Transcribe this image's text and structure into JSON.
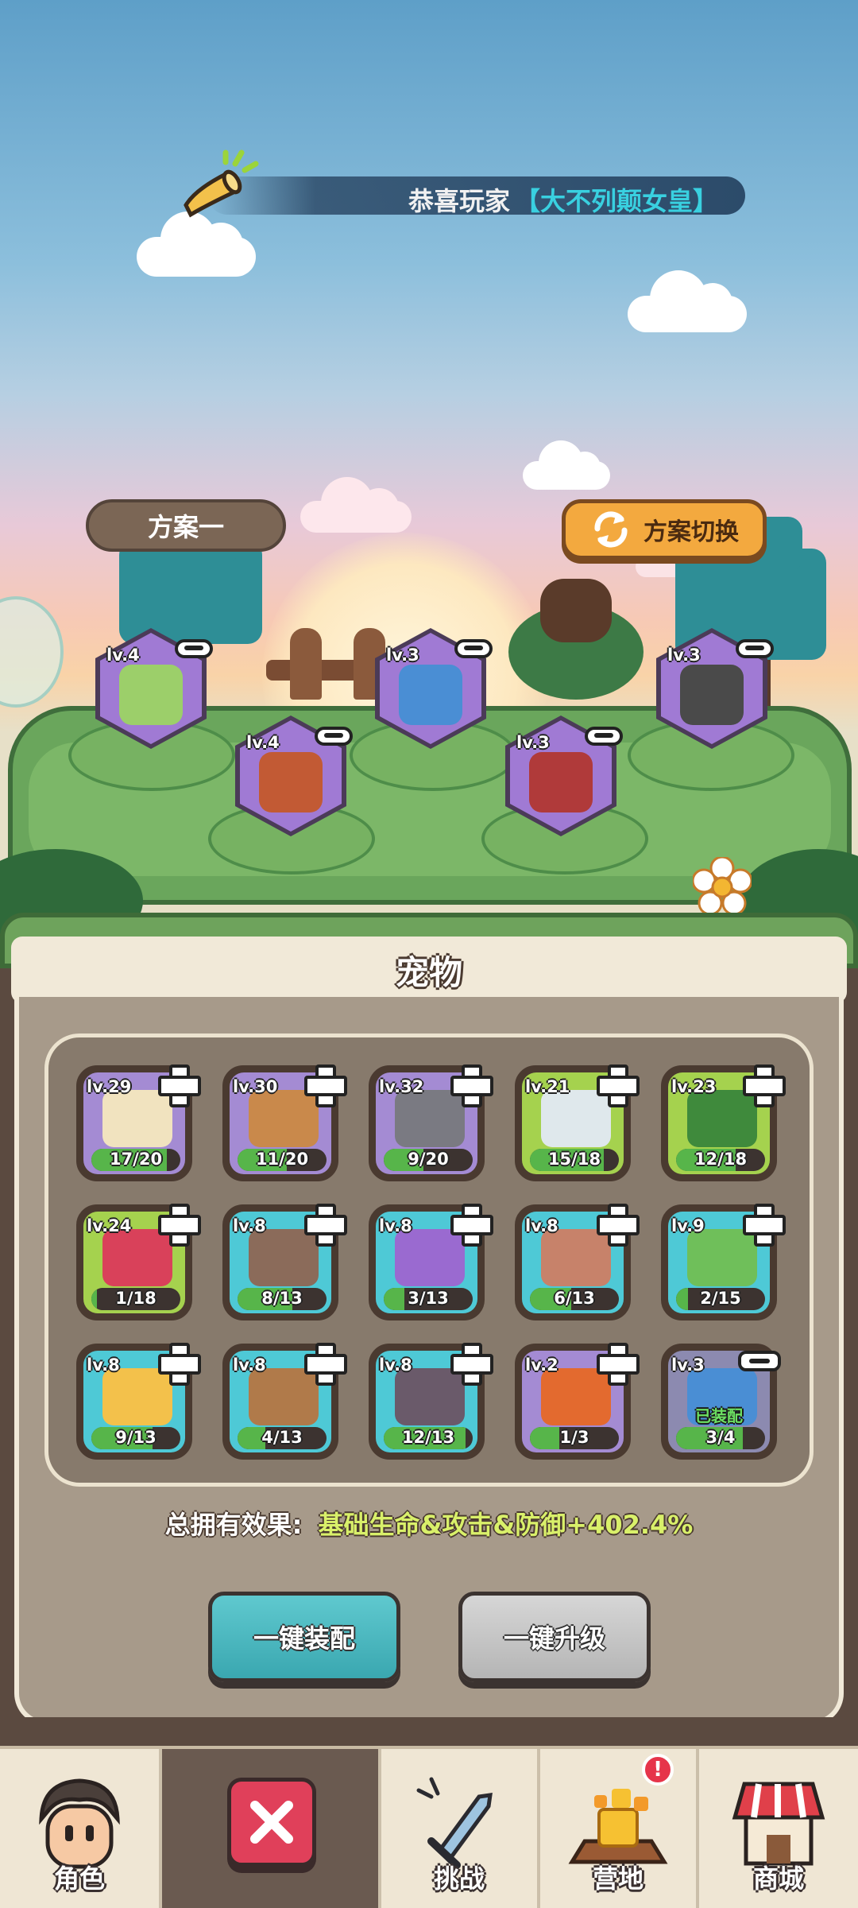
{
  "announcement": {
    "prefix": "恭喜玩家",
    "name": "【大不列颠女皇】"
  },
  "plan": {
    "current": "方案一",
    "switch_label": "方案切换"
  },
  "equipped": [
    {
      "lv": "lv.4",
      "color": "#9ccf6a"
    },
    {
      "lv": "lv.4",
      "color": "#c25a34"
    },
    {
      "lv": "lv.3",
      "color": "#4a8ed4"
    },
    {
      "lv": "lv.3",
      "color": "#b03a3a"
    },
    {
      "lv": "lv.3",
      "color": "#4a4a4a"
    }
  ],
  "panel": {
    "title": "宠物"
  },
  "pets": [
    {
      "lv": "lv.29",
      "count": "17/20",
      "progress": 0.85,
      "frame": "#a48bd3",
      "pet_color": "#f1e3bf",
      "action": "plus"
    },
    {
      "lv": "lv.30",
      "count": "11/20",
      "progress": 0.55,
      "frame": "#a48bd3",
      "pet_color": "#c9894b",
      "action": "plus"
    },
    {
      "lv": "lv.32",
      "count": "9/20",
      "progress": 0.45,
      "frame": "#a48bd3",
      "pet_color": "#7a7a82",
      "action": "plus"
    },
    {
      "lv": "lv.21",
      "count": "15/18",
      "progress": 0.83,
      "frame": "#a5d24e",
      "pet_color": "#dfe8ec",
      "action": "plus"
    },
    {
      "lv": "lv.23",
      "count": "12/18",
      "progress": 0.67,
      "frame": "#a5d24e",
      "pet_color": "#3f8a3c",
      "action": "plus"
    },
    {
      "lv": "lv.24",
      "count": "1/18",
      "progress": 0.06,
      "frame": "#a5d24e",
      "pet_color": "#d9415a",
      "action": "plus"
    },
    {
      "lv": "lv.8",
      "count": "8/13",
      "progress": 0.62,
      "frame": "#4ec9d6",
      "pet_color": "#8b6b5a",
      "action": "plus"
    },
    {
      "lv": "lv.8",
      "count": "3/13",
      "progress": 0.23,
      "frame": "#4ec9d6",
      "pet_color": "#9a6ad0",
      "action": "plus"
    },
    {
      "lv": "lv.8",
      "count": "6/13",
      "progress": 0.46,
      "frame": "#4ec9d6",
      "pet_color": "#c7826a",
      "action": "plus"
    },
    {
      "lv": "lv.9",
      "count": "2/15",
      "progress": 0.13,
      "frame": "#4ec9d6",
      "pet_color": "#6fbf5a",
      "action": "plus"
    },
    {
      "lv": "lv.8",
      "count": "9/13",
      "progress": 0.69,
      "frame": "#4ec9d6",
      "pet_color": "#f3c14b",
      "action": "plus"
    },
    {
      "lv": "lv.8",
      "count": "4/13",
      "progress": 0.31,
      "frame": "#4ec9d6",
      "pet_color": "#b07a4a",
      "action": "plus"
    },
    {
      "lv": "lv.8",
      "count": "12/13",
      "progress": 0.92,
      "frame": "#4ec9d6",
      "pet_color": "#6a5a6a",
      "action": "plus"
    },
    {
      "lv": "lv.2",
      "count": "1/3",
      "progress": 0.33,
      "frame": "#a48bd3",
      "pet_color": "#e36a2f",
      "action": "plus"
    },
    {
      "lv": "lv.3",
      "count": "3/4",
      "progress": 0.75,
      "frame": "#8c8ab0",
      "pet_color": "#4a8ed4",
      "action": "minus",
      "equipped_label": "已装配"
    }
  ],
  "effect": {
    "label": "总拥有效果:",
    "value": "基础生命&攻击&防御+402.4%"
  },
  "buttons": {
    "equip_all": "一键装配",
    "upgrade_all": "一键升级"
  },
  "nav": [
    {
      "label": "角色",
      "icon": "character-icon"
    },
    {
      "label": "",
      "icon": "close-icon",
      "active": true
    },
    {
      "label": "挑战",
      "icon": "sword-icon"
    },
    {
      "label": "营地",
      "icon": "campfire-icon",
      "badge": "!"
    },
    {
      "label": "商城",
      "icon": "shop-icon"
    }
  ]
}
